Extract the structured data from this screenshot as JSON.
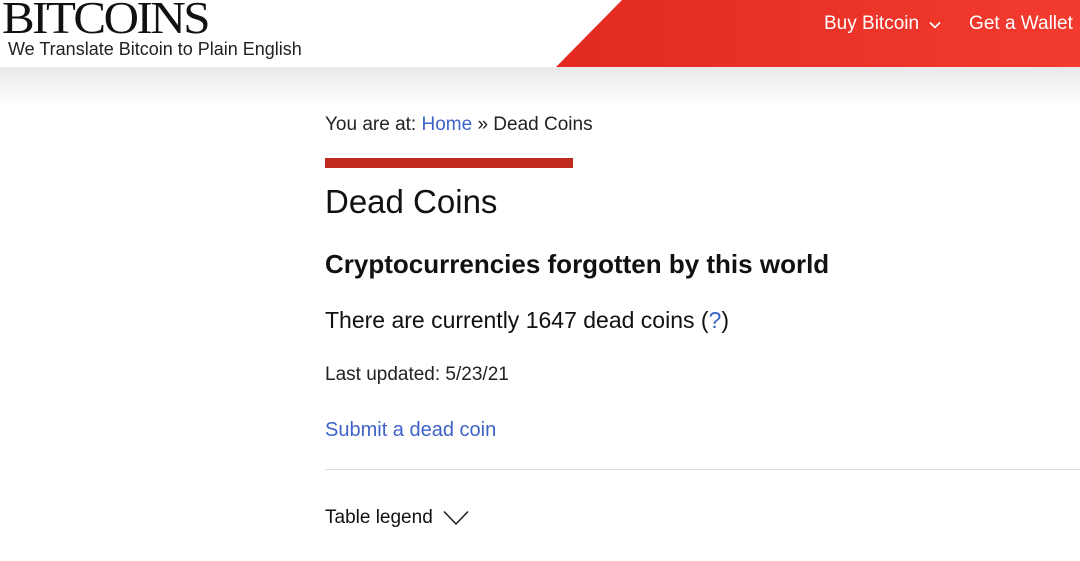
{
  "brand": {
    "logo_text": "BITCOINS",
    "tagline": "We Translate Bitcoin to Plain English",
    "accent_color": "#e8312a"
  },
  "nav": {
    "items": [
      {
        "label": "Buy Bitcoin",
        "icon": "chevron-down-icon"
      },
      {
        "label": "Get a Wallet"
      }
    ]
  },
  "breadcrumb": {
    "prefix": "You are at: ",
    "home": "Home",
    "separator": " » ",
    "current": "Dead Coins"
  },
  "page": {
    "title": "Dead Coins",
    "subtitle": "Cryptocurrencies forgotten by this world",
    "count_prefix": "There are currently 1647 dead coins (",
    "count_help": "?",
    "count_suffix": ")",
    "last_updated": "Last updated: 5/23/21",
    "submit_link": "Submit a dead coin",
    "legend_label": "Table legend"
  },
  "colors": {
    "link": "#3d63c9",
    "section_bar": "#c0291d"
  }
}
